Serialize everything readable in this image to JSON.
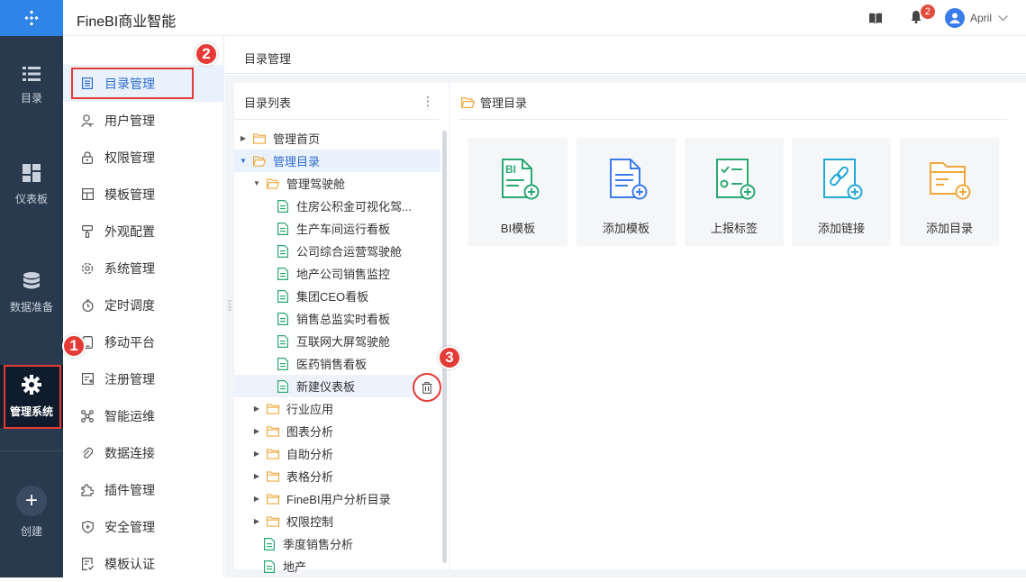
{
  "app": {
    "title": "FineBI商业智能"
  },
  "user": {
    "name": "April",
    "notification_count": "2"
  },
  "rail": [
    {
      "label": "目录",
      "icon": "list-icon"
    },
    {
      "label": "仪表板",
      "icon": "dashboard-icon"
    },
    {
      "label": "数据准备",
      "icon": "database-icon"
    },
    {
      "label": "管理系统",
      "icon": "gear-icon",
      "active": true
    },
    {
      "label": "创建",
      "icon": "plus-icon"
    }
  ],
  "menu": [
    {
      "label": "目录管理",
      "icon": "catalog-icon",
      "active": true
    },
    {
      "label": "用户管理",
      "icon": "user-icon"
    },
    {
      "label": "权限管理",
      "icon": "lock-icon"
    },
    {
      "label": "模板管理",
      "icon": "template-icon"
    },
    {
      "label": "外观配置",
      "icon": "brush-icon"
    },
    {
      "label": "系统管理",
      "icon": "gear-icon"
    },
    {
      "label": "定时调度",
      "icon": "timer-icon"
    },
    {
      "label": "移动平台",
      "icon": "mobile-icon"
    },
    {
      "label": "注册管理",
      "icon": "register-icon"
    },
    {
      "label": "智能运维",
      "icon": "network-icon"
    },
    {
      "label": "数据连接",
      "icon": "link-icon"
    },
    {
      "label": "插件管理",
      "icon": "plugin-icon"
    },
    {
      "label": "安全管理",
      "icon": "shield-icon"
    },
    {
      "label": "模板认证",
      "icon": "certificate-icon"
    }
  ],
  "breadcrumb": "目录管理",
  "tree": {
    "title": "目录列表",
    "more": "⋮",
    "rows": [
      {
        "label": "管理首页",
        "kind": "folder",
        "expanded": false
      },
      {
        "label": "管理目录",
        "kind": "folder",
        "expanded": true,
        "selected": true
      },
      {
        "label": "管理驾驶舱",
        "kind": "folder",
        "expanded": true
      },
      {
        "label": "住房公积金可视化驾...",
        "kind": "file"
      },
      {
        "label": "生产车间运行看板",
        "kind": "file"
      },
      {
        "label": "公司综合运营驾驶舱",
        "kind": "file"
      },
      {
        "label": "地产公司销售监控",
        "kind": "file"
      },
      {
        "label": "集团CEO看板",
        "kind": "file"
      },
      {
        "label": "销售总监实时看板",
        "kind": "file"
      },
      {
        "label": "互联网大屏驾驶舱",
        "kind": "file"
      },
      {
        "label": "医药销售看板",
        "kind": "file"
      },
      {
        "label": "新建仪表板",
        "kind": "file",
        "hover": true
      },
      {
        "label": "行业应用",
        "kind": "folder",
        "expanded": false
      },
      {
        "label": "图表分析",
        "kind": "folder",
        "expanded": false
      },
      {
        "label": "自助分析",
        "kind": "folder",
        "expanded": false
      },
      {
        "label": "表格分析",
        "kind": "folder",
        "expanded": false
      },
      {
        "label": "FineBI用户分析目录",
        "kind": "folder",
        "expanded": false
      },
      {
        "label": "权限控制",
        "kind": "folder",
        "expanded": false
      },
      {
        "label": "季度销售分析",
        "kind": "file"
      },
      {
        "label": "地产",
        "kind": "file"
      }
    ]
  },
  "main": {
    "title": "管理目录",
    "cards": [
      {
        "label": "BI模板",
        "icon": "bi-template-icon",
        "color": "#2aa872"
      },
      {
        "label": "添加模板",
        "icon": "add-template-icon",
        "color": "#3a7bec"
      },
      {
        "label": "上报标签",
        "icon": "report-tag-icon",
        "color": "#2aa872"
      },
      {
        "label": "添加链接",
        "icon": "add-link-icon",
        "color": "#22a7d8"
      },
      {
        "label": "添加目录",
        "icon": "add-folder-icon",
        "color": "#f0a73b"
      }
    ]
  },
  "markers": [
    "1",
    "2",
    "3"
  ],
  "colors": {
    "accent": "#2f6cd2",
    "rail": "#2a3a4e",
    "annotation": "#e43b36"
  }
}
